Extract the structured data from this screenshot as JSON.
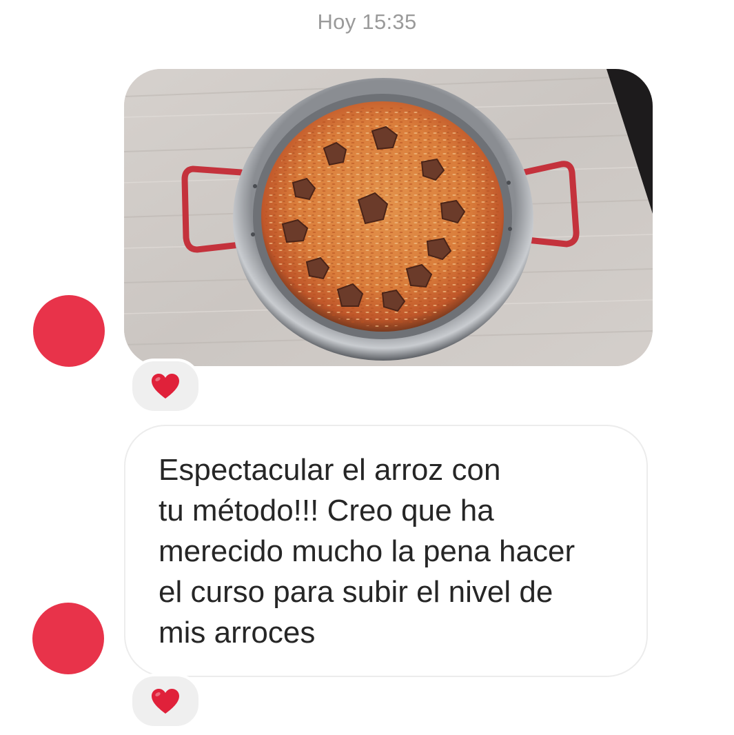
{
  "chat": {
    "timestamp": "Hoy 15:35",
    "messages": [
      {
        "type": "image",
        "image_description": "paella-pan-with-rice",
        "reaction": "heart"
      },
      {
        "type": "text",
        "lines": [
          "Espectacular el arroz con",
          "tu método!!! Creo que ha",
          "merecido mucho la pena hacer",
          "el curso para subir el nivel de",
          "mis arroces"
        ],
        "reaction": "heart"
      }
    ]
  },
  "colors": {
    "avatar": "#e8334a",
    "heart": "#e0213a",
    "bubble_border": "#ececec",
    "reaction_bg": "#efefef",
    "timestamp": "#9a9a9a",
    "text": "#262626"
  },
  "icons": {
    "reaction": "heart-icon",
    "avatar": "avatar"
  }
}
